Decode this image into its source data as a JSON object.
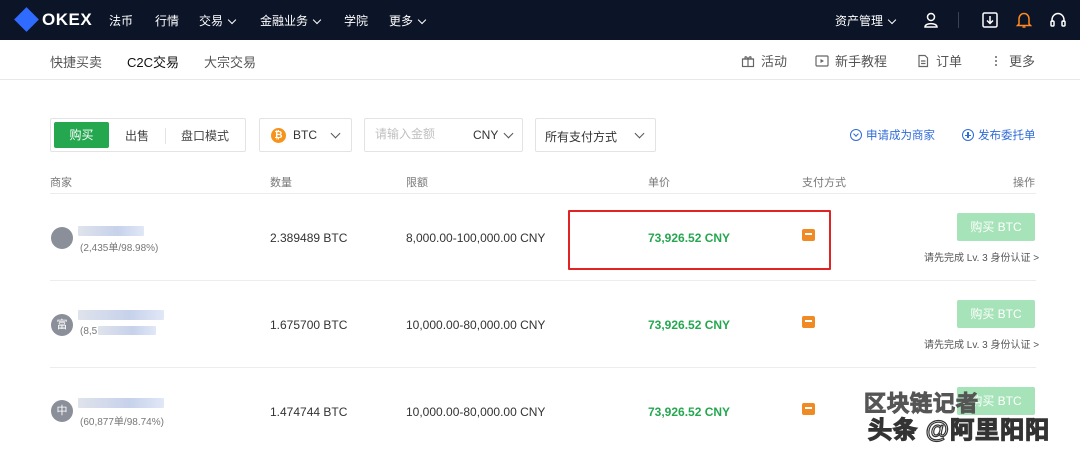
{
  "brand": {
    "name": "OKEX",
    "accent": "#2f6bff",
    "nav_bg": "#0c1427"
  },
  "topnav": {
    "items": [
      "法币",
      "行情",
      "交易",
      "金融业务",
      "学院",
      "更多"
    ],
    "asset_mgmt": "资产管理",
    "icons": [
      "user-icon",
      "download-icon",
      "bell-icon",
      "headset-icon"
    ]
  },
  "subnav": {
    "tabs": [
      "快捷买卖",
      "C2C交易",
      "大宗交易"
    ],
    "active_tab": "C2C交易",
    "right": [
      "活动",
      "新手教程",
      "订单",
      "更多"
    ]
  },
  "filters": {
    "mode": [
      "购买",
      "出售",
      "盘口模式"
    ],
    "coin": "BTC",
    "amount_placeholder": "请输入金额",
    "currency": "CNY",
    "payment": "所有支付方式",
    "apply_merchant": "申请成为商家",
    "post_order": "发布委托单"
  },
  "table": {
    "headers": [
      "商家",
      "数量",
      "限额",
      "单价",
      "支付方式",
      "操作"
    ],
    "rows": [
      {
        "avatar": "",
        "stats": "(2,435单/98.98%)",
        "amount": "2.389489 BTC",
        "limit": "8,000.00-100,000.00 CNY",
        "price": "73,926.52 CNY",
        "action": "购买 BTC",
        "note": "请先完成 Lv. 3 身份认证 >"
      },
      {
        "avatar": "富",
        "stats": "(8,5",
        "amount": "1.675700 BTC",
        "limit": "10,000.00-80,000.00 CNY",
        "price": "73,926.52 CNY",
        "action": "购买 BTC",
        "note": "请先完成 Lv. 3 身份认证 >"
      },
      {
        "avatar": "中",
        "stats": "(60,877单/98.74%)",
        "amount": "1.474744 BTC",
        "limit": "10,000.00-80,000.00 CNY",
        "price": "73,926.52 CNY",
        "action": "购买 BTC",
        "note": ""
      }
    ],
    "price_color": "#25a750",
    "highlight_color": "#e02424"
  },
  "watermark": {
    "line1": "区块链记者",
    "line2": "头条 @阿里阳阳"
  }
}
